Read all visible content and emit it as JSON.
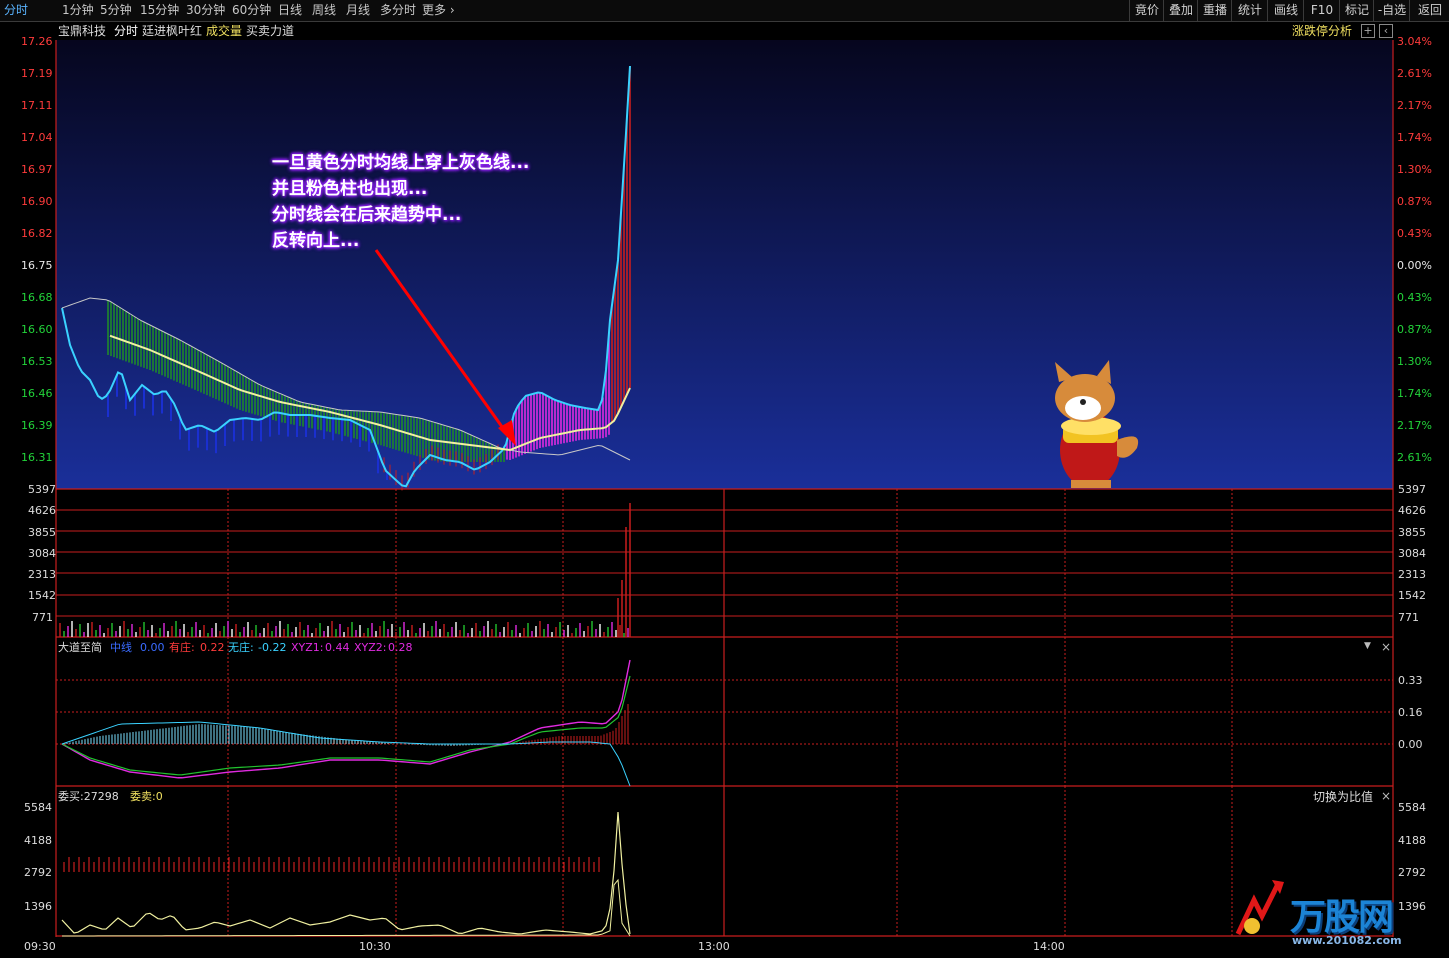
{
  "topbar": {
    "tabs": [
      "分时",
      "1分钟",
      "5分钟",
      "15分钟",
      "30分钟",
      "60分钟",
      "日线",
      "周线",
      "月线",
      "多分时",
      "更多"
    ],
    "tools": [
      "竟价",
      "叠加",
      "重播",
      "统计",
      "画线",
      "F10",
      "标记",
      "-自选",
      "返回"
    ]
  },
  "header": {
    "stock": "宝鼎科技",
    "mode": "分时",
    "author": "廷进枫叶红",
    "vol_label": "成交量",
    "force_label": "买卖力道",
    "limit_btn": "涨跌停分析"
  },
  "price_axis": {
    "left": [
      "17.26",
      "17.19",
      "17.11",
      "17.04",
      "16.97",
      "16.90",
      "16.82",
      "16.75",
      "16.68",
      "16.60",
      "16.53",
      "16.46",
      "16.39",
      "16.31"
    ],
    "right": [
      "3.04%",
      "2.61%",
      "2.17%",
      "1.74%",
      "1.30%",
      "0.87%",
      "0.43%",
      "0.00%",
      "0.43%",
      "0.87%",
      "1.30%",
      "1.74%",
      "2.17%",
      "2.61%"
    ]
  },
  "volume_axis": [
    "5397",
    "4626",
    "3855",
    "3084",
    "2313",
    "1542",
    "771"
  ],
  "annotation": [
    "一旦黄色分时均线上穿上灰色线...",
    "并且粉色柱也出现...",
    "分时线会在后来趋势中...",
    "反转向上..."
  ],
  "indicator": {
    "name": "大道至简",
    "mid_label": "中线",
    "mid_val": "0.00",
    "you_label": "有庄:",
    "you_val": "0.22",
    "wu_label": "无庄:",
    "wu_val": "-0.22",
    "x1_label": "XYZ1:",
    "x1_val": "0.44",
    "x2_label": "XYZ2:",
    "x2_val": "0.28",
    "axis": [
      "0.33",
      "0.16",
      "0.00"
    ]
  },
  "order": {
    "buy": "委买:27298",
    "sell": "委卖:0",
    "switch": "切换为比值",
    "axis": [
      "5584",
      "4188",
      "2792",
      "1396"
    ]
  },
  "time_axis": [
    "09:30",
    "10:30",
    "13:00",
    "14:00"
  ],
  "watermark": {
    "brand": "万股网",
    "url": "www.201082.com"
  },
  "colors": {
    "red_line": "#c81e1e",
    "green": "#22c32f",
    "magenta": "#e02be0",
    "cyan": "#3ad2ff",
    "yellow": "#f0e060"
  }
}
